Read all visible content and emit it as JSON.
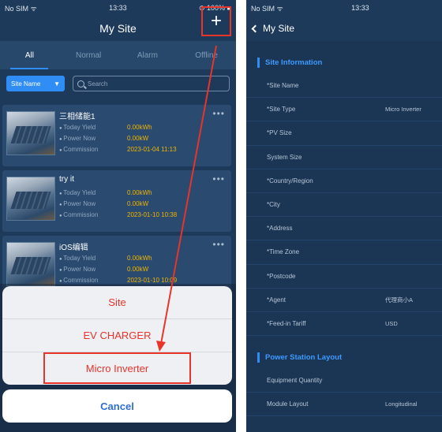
{
  "left": {
    "status": {
      "carrier": "No SIM ᯤ",
      "time": "13:33",
      "battery": "⊙ 100% ■"
    },
    "title": "My Site",
    "add_label": "+",
    "tabs": [
      {
        "label": "All"
      },
      {
        "label": "Normal"
      },
      {
        "label": "Alarm"
      },
      {
        "label": "Offline"
      }
    ],
    "filter": {
      "select_label": "Site Name",
      "search_placeholder": "Search"
    },
    "cards": [
      {
        "name": "三相储能1",
        "today_label": "Today Yield",
        "today_value": "0.00kWh",
        "power_label": "Power Now",
        "power_value": "0.00kW",
        "comm_label": "Commission",
        "comm_value": "2023-01-04 11:13"
      },
      {
        "name": "try it",
        "today_label": "Today Yield",
        "today_value": "0.00kWh",
        "power_label": "Power Now",
        "power_value": "0.00kW",
        "comm_label": "Commission",
        "comm_value": "2023-01-10 10:38"
      },
      {
        "name": "iOS编辑",
        "today_label": "Today Yield",
        "today_value": "0.00kWh",
        "power_label": "Power Now",
        "power_value": "0.00kW",
        "comm_label": "Commission",
        "comm_value": "2023-01-10 10:09"
      }
    ],
    "sheet": {
      "options": [
        "Site",
        "EV CHARGER",
        "Micro Inverter"
      ],
      "cancel_label": "Cancel"
    }
  },
  "right": {
    "status": {
      "carrier": "No SIM ᯤ",
      "time": "13:33"
    },
    "back_label": "My Site",
    "section1_title": "Site Information",
    "site_fields": [
      {
        "label": "*Site Name",
        "value": ""
      },
      {
        "label": "*Site Type",
        "value": "Micro Inverter"
      },
      {
        "label": "*PV Size",
        "value": ""
      },
      {
        "label": "System Size",
        "value": ""
      },
      {
        "label": "*Country/Region",
        "value": ""
      },
      {
        "label": "*City",
        "value": ""
      },
      {
        "label": "*Address",
        "value": ""
      },
      {
        "label": "*Time Zone",
        "value": ""
      },
      {
        "label": "*Postcode",
        "value": ""
      },
      {
        "label": "*Agent",
        "value": "代理商小A"
      },
      {
        "label": "*Feed-in Tariff",
        "value": "USD"
      }
    ],
    "section2_title": "Power Station Layout",
    "layout_fields": [
      {
        "label": "Equipment Quantity",
        "value": ""
      },
      {
        "label": "Module Layout",
        "value": "Longitudinal"
      }
    ]
  },
  "colors": {
    "accent": "#2f8df5",
    "highlight": "#e8342a",
    "yield": "#f0b400",
    "background": "#1d3a5b"
  }
}
